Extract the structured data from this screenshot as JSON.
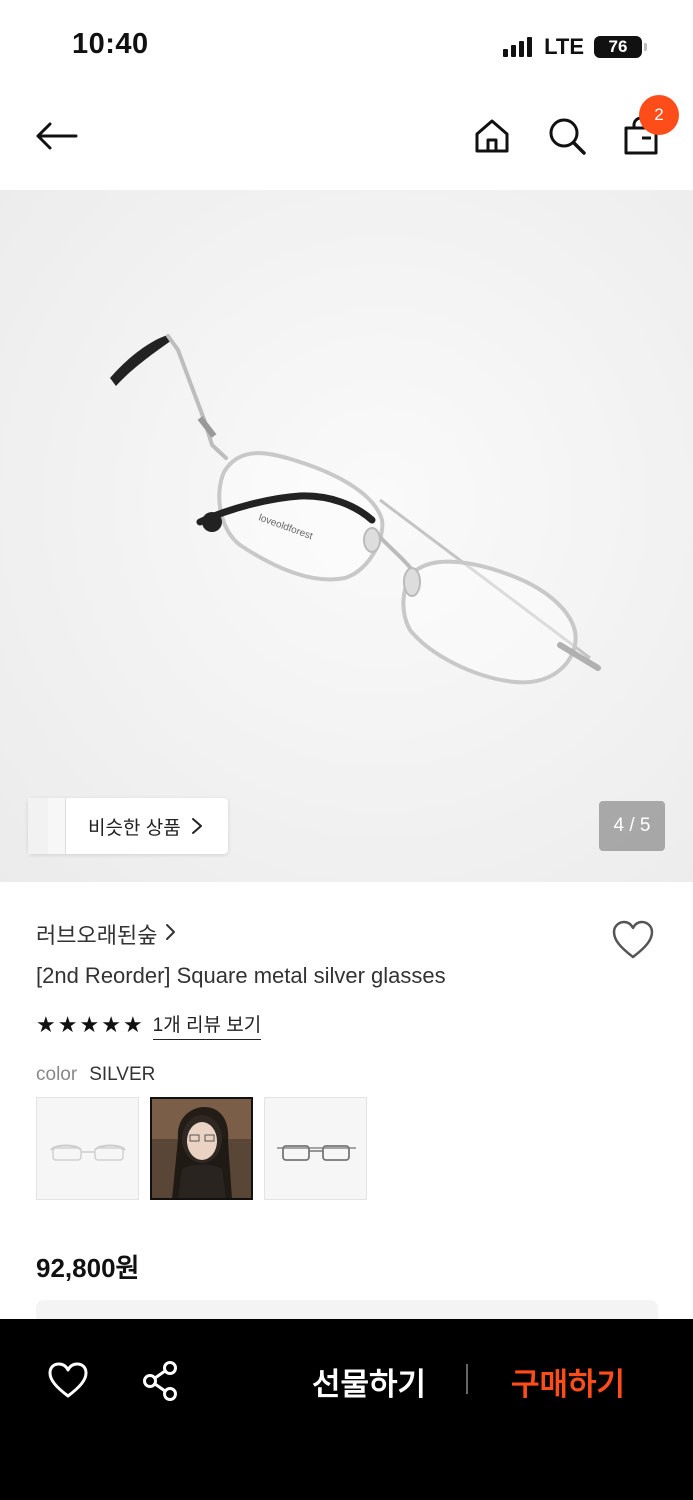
{
  "status_bar": {
    "time": "10:40",
    "network": "LTE",
    "battery": "76"
  },
  "nav": {
    "cart_count": "2",
    "icons": [
      "arrow-left-icon",
      "home-icon",
      "search-icon",
      "shopping-bag-icon"
    ]
  },
  "gallery": {
    "similar_label": "비슷한 상품",
    "page_indicator": "4 / 5"
  },
  "product": {
    "brand": "러브오래된숲",
    "title": "[2nd Reorder] Square metal silver glasses",
    "rating_stars": 5,
    "review_link": "1개 리뷰 보기",
    "color_label": "color",
    "color_value": "SILVER",
    "swatches": [
      "swatch-1",
      "swatch-2",
      "swatch-3"
    ],
    "price": "92,800원"
  },
  "bottom_bar": {
    "gift_label": "선물하기",
    "buy_label": "구매하기",
    "accent_color": "#ff4d1a"
  }
}
